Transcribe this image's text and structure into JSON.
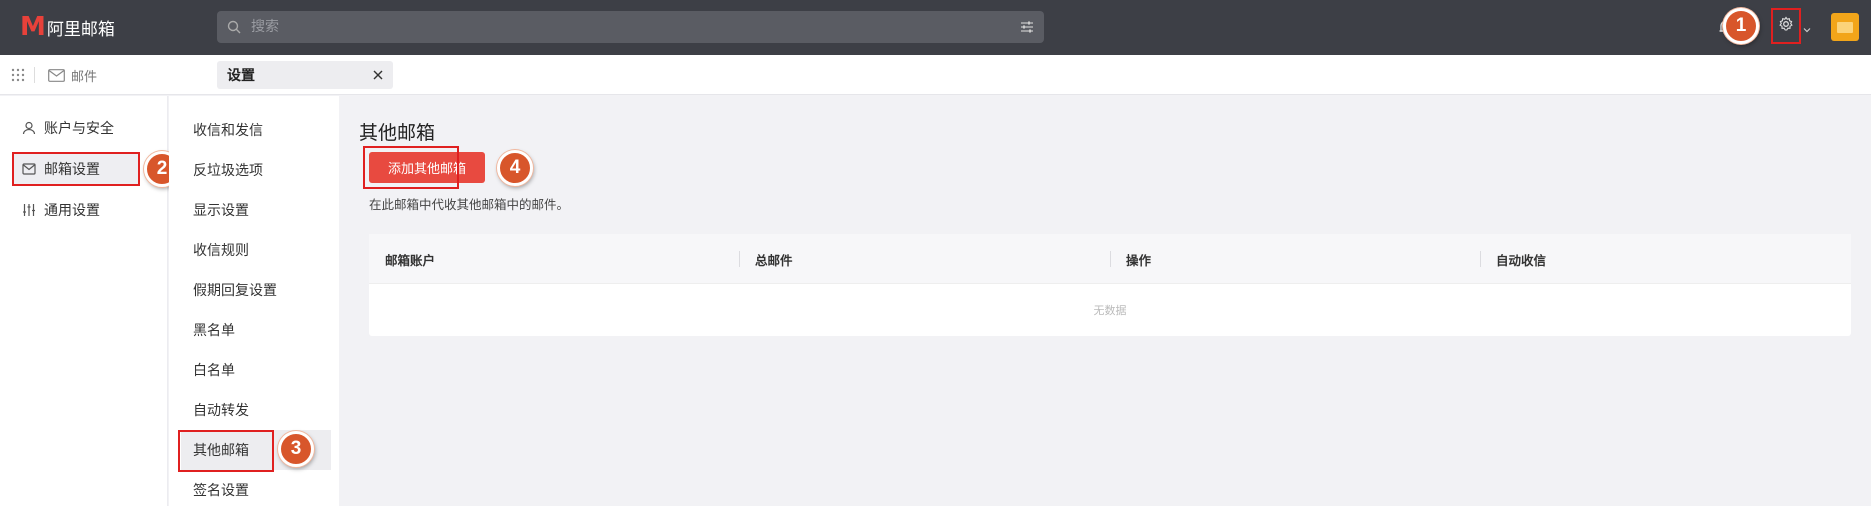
{
  "app": {
    "logo_mark": "M",
    "name": "阿里邮箱"
  },
  "search": {
    "placeholder": "搜索"
  },
  "tabs": {
    "mail_label": "邮件",
    "settings_label": "设置"
  },
  "primary_nav": [
    {
      "label": "账户与安全",
      "icon": "user-icon"
    },
    {
      "label": "邮箱设置",
      "icon": "mailbox-icon",
      "active": true
    },
    {
      "label": "通用设置",
      "icon": "sliders-icon"
    }
  ],
  "secondary_nav": [
    {
      "label": "收信和发信"
    },
    {
      "label": "反垃圾选项"
    },
    {
      "label": "显示设置"
    },
    {
      "label": "收信规则"
    },
    {
      "label": "假期回复设置"
    },
    {
      "label": "黑名单"
    },
    {
      "label": "白名单"
    },
    {
      "label": "自动转发"
    },
    {
      "label": "其他邮箱",
      "active": true
    },
    {
      "label": "签名设置"
    }
  ],
  "main": {
    "title": "其他邮箱",
    "add_button": "添加其他邮箱",
    "description": "在此邮箱中代收其他邮箱中的邮件。",
    "table": {
      "columns": [
        "邮箱账户",
        "总邮件",
        "操作",
        "自动收信"
      ],
      "empty_text": "无数据"
    }
  },
  "steps": [
    "1",
    "2",
    "3",
    "4"
  ],
  "colors": {
    "topbar": "#3d3f46",
    "accent": "#e84a40",
    "highlight_border": "#e02020",
    "step_badge": "#d8562b",
    "avatar": "#f2a51a"
  }
}
